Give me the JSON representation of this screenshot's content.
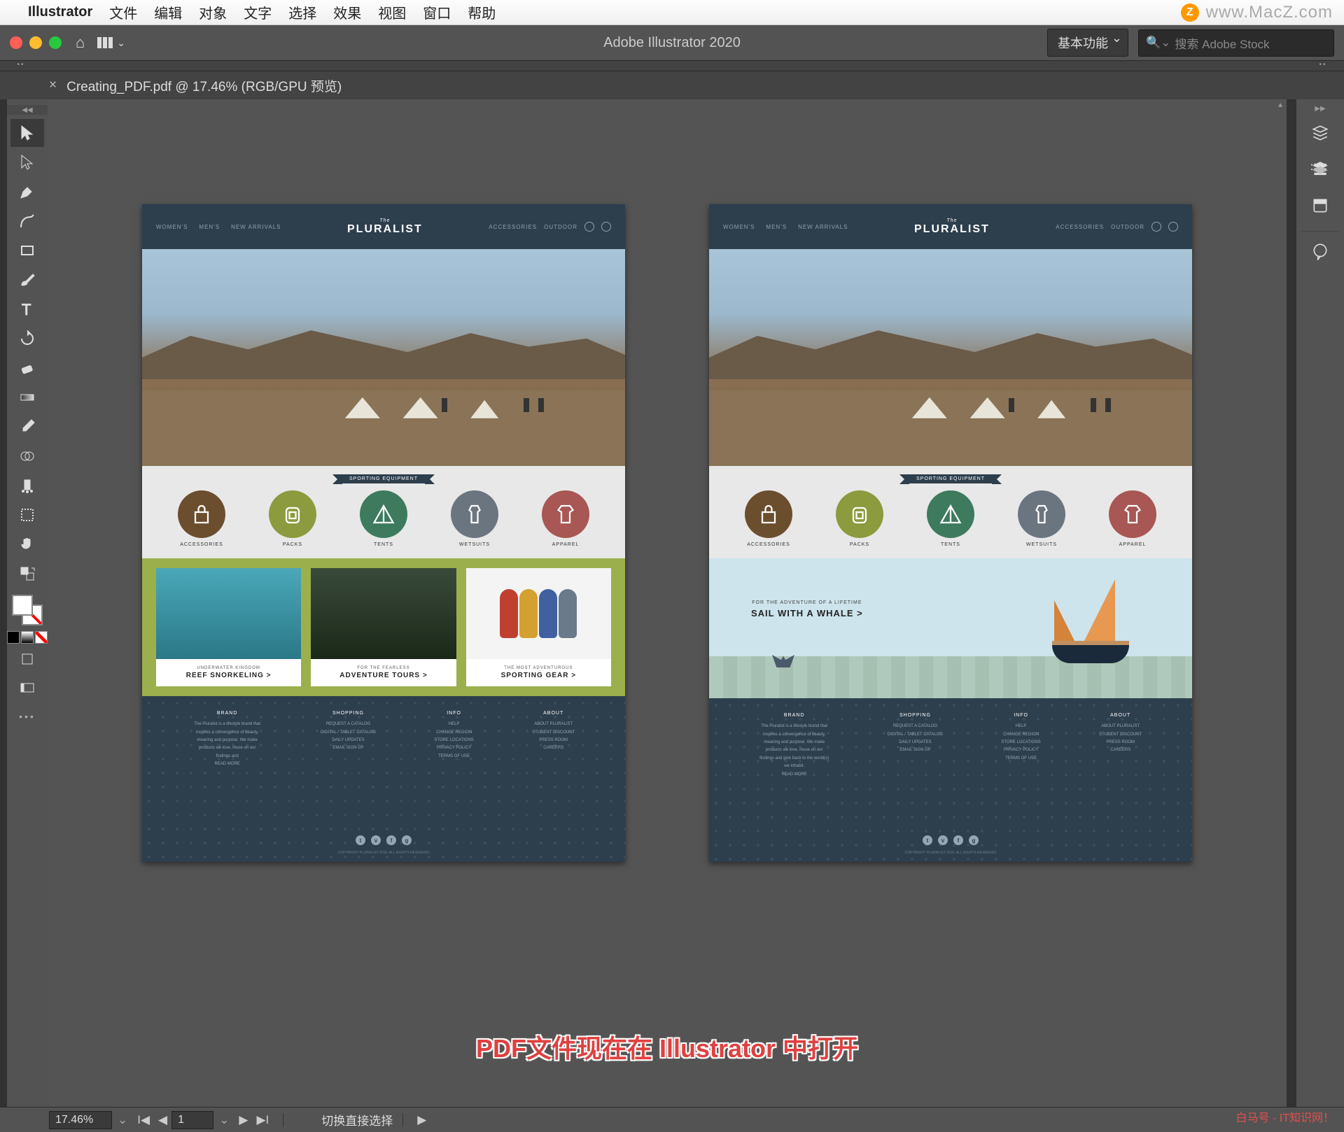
{
  "mac_menu": {
    "app": "Illustrator",
    "items": [
      "文件",
      "编辑",
      "对象",
      "文字",
      "选择",
      "效果",
      "视图",
      "窗口",
      "帮助"
    ],
    "watermark": "www.MacZ.com",
    "z": "Z"
  },
  "titlebar": {
    "app_title": "Adobe Illustrator 2020",
    "workspace": "基本功能",
    "stock_placeholder": "搜索 Adobe Stock"
  },
  "doc_tab": {
    "label": "Creating_PDF.pdf @ 17.46% (RGB/GPU 预览)"
  },
  "status": {
    "zoom": "17.46%",
    "artboard": "1",
    "tool_hint": "切换直接选择"
  },
  "annotation": "PDF文件现在在 Illustrator 中打开",
  "bm_watermark": "白马号 - IT知识网！",
  "tools": {
    "selection": "selection-tool",
    "direct": "direct-selection-tool",
    "pen": "pen-tool",
    "curvature": "curvature-tool",
    "rectangle": "rectangle-tool",
    "brush": "paintbrush-tool",
    "type": "type-tool",
    "rotate": "rotate-tool",
    "eraser": "eraser-tool",
    "gradient": "gradient-tool",
    "eyedropper": "eyedropper-tool",
    "blend": "blend-tool",
    "symbol": "symbol-sprayer-tool",
    "artboard": "artboard-tool",
    "hand": "hand-tool"
  },
  "right_panels": [
    "properties",
    "layers",
    "libraries",
    "comments"
  ],
  "mockup": {
    "nav": [
      "WOMEN'S",
      "MEN'S",
      "NEW ARRIVALS"
    ],
    "nav_right": [
      "ACCESSORIES",
      "OUTDOOR"
    ],
    "logo_the": "The",
    "logo_name": "PLURALIST",
    "hero": "OUTDOOR",
    "ribbon": "SPORTING EQUIPMENT",
    "categories": [
      {
        "label": "ACCESSORIES",
        "color": "c1"
      },
      {
        "label": "PACKS",
        "color": "c2"
      },
      {
        "label": "TENTS",
        "color": "c3"
      },
      {
        "label": "WETSUITS",
        "color": "c4"
      },
      {
        "label": "APPAREL",
        "color": "c5"
      }
    ],
    "features": [
      {
        "sub": "UNDERWATER KINGDOM",
        "title": "REEF SNORKELING >"
      },
      {
        "sub": "FOR THE FEARLESS",
        "title": "ADVENTURE TOURS >"
      },
      {
        "sub": "THE MOST ADVENTUROUS",
        "title": "SPORTING GEAR >"
      }
    ],
    "sail": {
      "sub": "FOR THE ADVENTURE OF A LIFETIME",
      "title": "SAIL WITH A WHALE >"
    },
    "footer": {
      "cols": [
        {
          "h": "BRAND",
          "items": [
            "The Pluralist is a lifestyle brand that inspires a convergence of beauty, meaning and purpose. We make products we love, muse on our findings and",
            "READ MORE"
          ]
        },
        {
          "h": "SHOPPING",
          "items": [
            "REQUEST A CATALOG",
            "DIGITAL / TABLET CATALOG",
            "DAILY UPDATES",
            "EMAIL SIGN UP"
          ]
        },
        {
          "h": "INFO",
          "items": [
            "HELP",
            "CHANGE REGION",
            "STORE LOCATIONS",
            "PRIVACY POLICY",
            "TERMS OF USE"
          ]
        },
        {
          "h": "ABOUT",
          "items": [
            "ABOUT PLURALIST",
            "STUDENT DISCOUNT",
            "PRESS ROOM",
            "CAREERS"
          ]
        }
      ],
      "cols_alt_brand": [
        "The Pluralist is a lifestyle brand that inspires a convergence of beauty, meaning and purpose. We make products we love, muse on our findings and give back to the world(s) we inhabit.",
        "READ MORE"
      ],
      "social_icons": [
        "t",
        "v",
        "f",
        "g"
      ],
      "copy": "COPYRIGHT PLURALIST 2015. ALL RIGHTS RESERVED"
    }
  }
}
